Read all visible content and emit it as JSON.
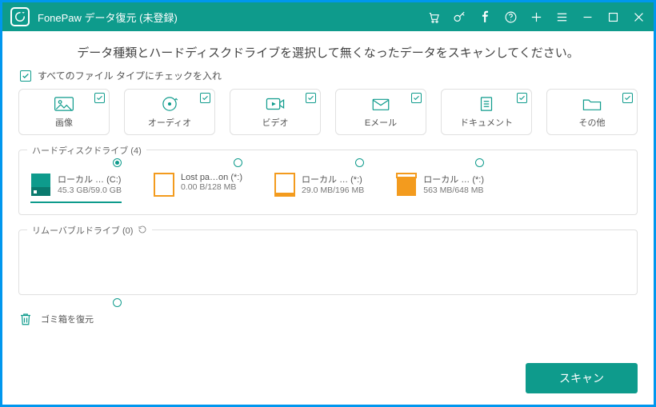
{
  "title": "FonePaw データ復元 (未登録)",
  "subtitle": "データ種類とハードディスクドライブを選択して無くなったデータをスキャンしてください。",
  "check_all_label": "すべてのファイル タイプにチェックを入れ",
  "filetypes": {
    "image": "画像",
    "audio": "オーディオ",
    "video": "ビデオ",
    "email": "Eメール",
    "document": "ドキュメント",
    "other": "その他"
  },
  "hdd_section_label": "ハードディスクドライブ (4)",
  "drives": {
    "d0": {
      "name": "ローカル … (C:)",
      "size": "45.3 GB/59.0 GB"
    },
    "d1": {
      "name": "Lost pa…on (*:)",
      "size": "0.00  B/128 MB"
    },
    "d2": {
      "name": "ローカル … (*:)",
      "size": "29.0 MB/196 MB"
    },
    "d3": {
      "name": "ローカル … (*:)",
      "size": "563 MB/648 MB"
    }
  },
  "removable_section_label": "リムーバブルドライブ (0)",
  "trash_label": "ゴミ箱を復元",
  "scan_button": "スキャン",
  "colors": {
    "accent": "#0e9b8c",
    "border": "#0097ee",
    "orange": "#f39b1e"
  }
}
